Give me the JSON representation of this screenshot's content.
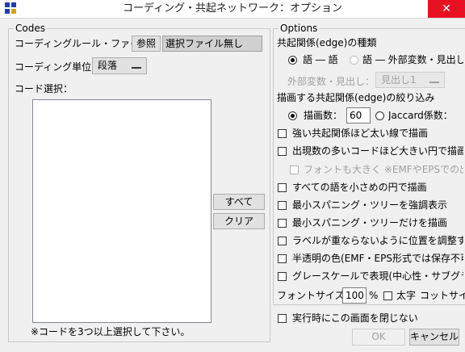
{
  "window": {
    "title": "コーディング・共起ネットワーク：オプション",
    "close_glyph": "✕"
  },
  "codes": {
    "legend": "Codes",
    "rule_file_label": "コーディングルール・ファイル：",
    "browse_button": "参照",
    "rule_file_value": "選択ファイル無し",
    "unit_label": "コーディング単位：",
    "unit_value": "段落",
    "select_label": "コード選択：",
    "all_button": "すべて",
    "clear_button": "クリア",
    "note": "※コードを3つ以上選択して下さい。"
  },
  "options": {
    "legend": "Options",
    "edge_type_label": "共起関係(edge)の種類",
    "radio_word_word": "語 ― 語",
    "radio_word_var": "語 ― 外部変数・見出し",
    "ext_var_label": "外部変数・見出し：",
    "ext_var_value": "見出し1",
    "filter_label": "描画する共起関係(edge)の絞り込み",
    "draw_count_label": "描画数：",
    "draw_count_value": "60",
    "jaccard_label": "Jaccard係数：",
    "checks": [
      {
        "label": "強い共起関係ほど太い線で描画",
        "checked": false,
        "enabled": true
      },
      {
        "label": "出現数の多いコードほど大きい円で描画",
        "checked": false,
        "enabled": true
      },
      {
        "label": "フォントも大きく ※EMFやEPSでの出力・印刷向け",
        "checked": false,
        "enabled": false
      },
      {
        "label": "すべての語を小さめの円で描画",
        "checked": false,
        "enabled": true
      },
      {
        "label": "最小スパニング・ツリーを強調表示",
        "checked": false,
        "enabled": true
      },
      {
        "label": "最小スパニング・ツリーだけを描画",
        "checked": false,
        "enabled": true
      },
      {
        "label": "ラベルが重ならないように位置を調整する",
        "checked": false,
        "enabled": true
      },
      {
        "label": "半透明の色(EMF・EPS形式では保存不可)",
        "checked": false,
        "enabled": true
      },
      {
        "label": "グレースケールで表現(中心性・サブグラフ)",
        "checked": false,
        "enabled": true
      }
    ],
    "font_size_label": "フォントサイズ：",
    "font_size_value": "100",
    "font_size_unit": "%",
    "bold_label": "太字",
    "cotsize_label": "コットサイズ"
  },
  "footer": {
    "close_on_run_label": "実行時にこの画面を閉じない",
    "ok_button": "OK",
    "cancel_button": "キャンセル"
  }
}
